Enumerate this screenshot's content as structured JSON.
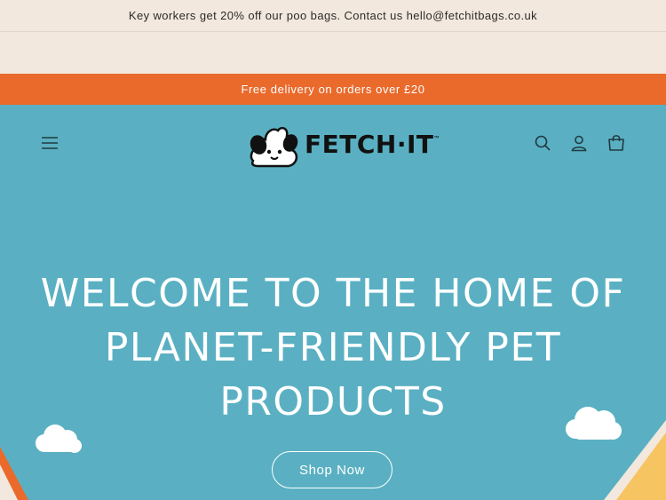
{
  "announcement": {
    "text": "Key workers get 20% off our poo bags. Contact us hello@fetchitbags.co.uk"
  },
  "promo": {
    "text": "Free delivery on orders over £20"
  },
  "header": {
    "logo_text": "FETCH·IT",
    "logo_tm": "™",
    "icons": [
      "menu-icon",
      "search-icon",
      "account-icon",
      "cart-icon"
    ]
  },
  "hero": {
    "headline": "WELCOME TO THE HOME OF PLANET-FRIENDLY PET PRODUCTS",
    "cta_label": "Shop Now"
  },
  "colors": {
    "page_bg": "#f3e8dd",
    "promo_bg": "#ea6a2c",
    "hero_bg": "#5ab0c2",
    "text_dark": "#2b2b2b"
  }
}
